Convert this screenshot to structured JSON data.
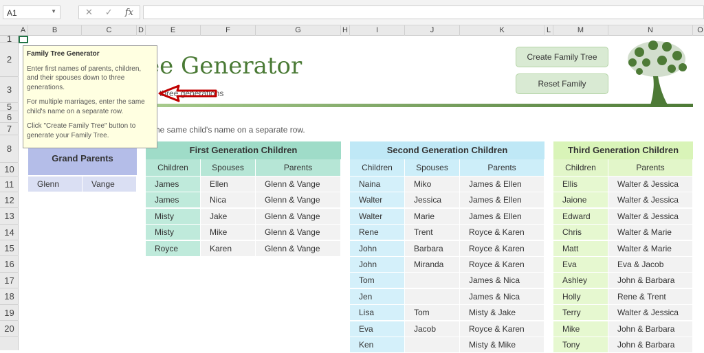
{
  "formula_bar": {
    "name_box": "A1",
    "fx": "fx",
    "formula": ""
  },
  "columns": [
    "A",
    "B",
    "C",
    "D",
    "E",
    "F",
    "G",
    "H",
    "I",
    "J",
    "K",
    "L",
    "M",
    "N",
    "O"
  ],
  "rows": [
    "1",
    "2",
    "3",
    "5",
    "6",
    "7",
    "8",
    "10",
    "11",
    "12",
    "13",
    "14",
    "15",
    "16",
    "17",
    "18",
    "19",
    "20"
  ],
  "header": {
    "title": "ee Generator",
    "subtitle": "o three generations",
    "instruction": "he same child's name on a separate row."
  },
  "buttons": {
    "create": "Create Family Tree",
    "reset": "Reset Family"
  },
  "tooltip": {
    "title": "Family Tree Generator",
    "p1": "Enter first names of parents, children, and their spouses down to three generations.",
    "p2": "For multiple marriages, enter the same child's name on a separate row.",
    "p3": "Click \"Create Family Tree\" button to generate your Family Tree."
  },
  "grand": {
    "title": "Grand Parents",
    "rows": [
      [
        "Glenn",
        "Vange"
      ]
    ]
  },
  "gen1": {
    "title": "First Generation Children",
    "headers": [
      "Children",
      "Spouses",
      "Parents"
    ],
    "rows": [
      [
        "James",
        "Ellen",
        "Glenn & Vange"
      ],
      [
        "James",
        "Nica",
        "Glenn & Vange"
      ],
      [
        "Misty",
        "Jake",
        "Glenn & Vange"
      ],
      [
        "Misty",
        "Mike",
        "Glenn & Vange"
      ],
      [
        "Royce",
        "Karen",
        "Glenn & Vange"
      ]
    ]
  },
  "gen2": {
    "title": "Second Generation Children",
    "headers": [
      "Children",
      "Spouses",
      "Parents"
    ],
    "rows": [
      [
        "Naina",
        "Miko",
        "James & Ellen"
      ],
      [
        "Walter",
        "Jessica",
        "James & Ellen"
      ],
      [
        "Walter",
        "Marie",
        "James & Ellen"
      ],
      [
        "Rene",
        "Trent",
        "Royce & Karen"
      ],
      [
        "John",
        "Barbara",
        "Royce & Karen"
      ],
      [
        "John",
        "Miranda",
        "Royce & Karen"
      ],
      [
        "Tom",
        "",
        "James & Nica"
      ],
      [
        "Jen",
        "",
        "James & Nica"
      ],
      [
        "Lisa",
        "Tom",
        "Misty & Jake"
      ],
      [
        "Eva",
        "Jacob",
        "Royce & Karen"
      ],
      [
        "Ken",
        "",
        "Misty & Mike"
      ]
    ]
  },
  "gen3": {
    "title": "Third Generation Children",
    "headers": [
      "Children",
      "Parents"
    ],
    "rows": [
      [
        "Ellis",
        "Walter & Jessica"
      ],
      [
        "Jaione",
        "Walter & Jessica"
      ],
      [
        "Edward",
        "Walter & Jessica"
      ],
      [
        "Chris",
        "Walter & Marie"
      ],
      [
        "Matt",
        "Walter & Marie"
      ],
      [
        "Eva",
        "Eva & Jacob"
      ],
      [
        "Ashley",
        "John & Barbara"
      ],
      [
        "Holly",
        "Rene & Trent"
      ],
      [
        "Terry",
        "Walter & Jessica"
      ],
      [
        "Mike",
        "John & Barbara"
      ],
      [
        "Tony",
        "John & Barbara"
      ]
    ]
  },
  "colors": {
    "green": "#4a7a35",
    "gen1": "#9fdcc8",
    "gen2": "#bfe8f6",
    "gen3": "#d9f4b8",
    "grand": "#b4bde8"
  }
}
